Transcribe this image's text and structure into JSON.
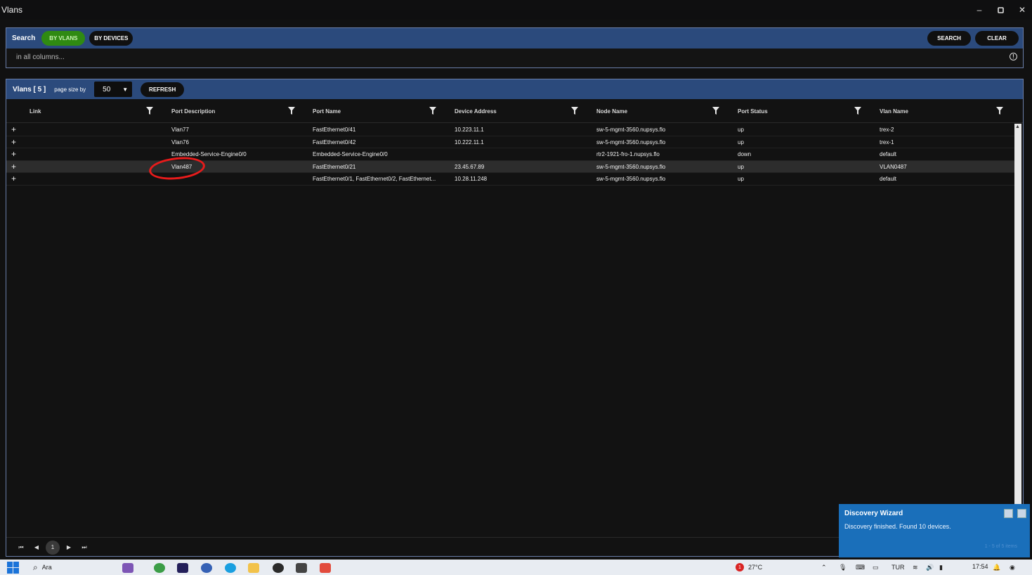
{
  "window": {
    "title": "Vlans"
  },
  "search": {
    "label": "Search",
    "mode_vlans": "BY VLANS",
    "mode_devices": "BY DEVICES",
    "search_button": "SEARCH",
    "clear_button": "CLEAR",
    "placeholder": "in all columns..."
  },
  "grid": {
    "count_label": "Vlans [ 5 ]",
    "page_size_label": "page size by",
    "page_size": "50",
    "refresh_button": "REFRESH",
    "columns": [
      "Link",
      "Port Description",
      "Port Name",
      "Device Address",
      "Node Name",
      "Port Status",
      "Vlan Name"
    ],
    "rows": [
      {
        "desc": "Vlan77",
        "port": "FastEthernet0/41",
        "addr": "10.223.11.1",
        "node": "sw-5-mgmt-3560.nupsys.flo",
        "status": "up",
        "vlan": "trex-2"
      },
      {
        "desc": "Vlan76",
        "port": "FastEthernet0/42",
        "addr": "10.222.11.1",
        "node": "sw-5-mgmt-3560.nupsys.flo",
        "status": "up",
        "vlan": "trex-1"
      },
      {
        "desc": "Embedded-Service-Engine0/0",
        "port": "Embedded-Service-Engine0/0",
        "addr": "",
        "node": "rtr2-1921-fro-1.nupsys.flo",
        "status": "down",
        "vlan": "default"
      },
      {
        "desc": "Vlan487",
        "port": "FastEthernet0/21",
        "addr": "23.45.67.89",
        "node": "sw-5-mgmt-3560.nupsys.flo",
        "status": "up",
        "vlan": "VLAN0487"
      },
      {
        "desc": "",
        "port": "FastEthernet0/1, FastEthernet0/2, FastEthernet...",
        "addr": "10.28.11.248",
        "node": "sw-5-mgmt-3560.nupsys.flo",
        "status": "up",
        "vlan": "default"
      }
    ],
    "current_page": "1"
  },
  "toast": {
    "title": "Discovery Wizard",
    "message": "Discovery finished. Found 10 devices.",
    "footer": "1 - 5 of 5 items"
  },
  "taskbar": {
    "search_placeholder": "Ara",
    "weather_temp": "27°C",
    "weather_badge": "1",
    "language": "TUR",
    "time": "17:54"
  },
  "icons": [
    "windows-logo-icon",
    "search-icon",
    "filter-icon",
    "info-icon",
    "minimize-icon",
    "maximize-icon",
    "close-icon",
    "plus-icon"
  ]
}
